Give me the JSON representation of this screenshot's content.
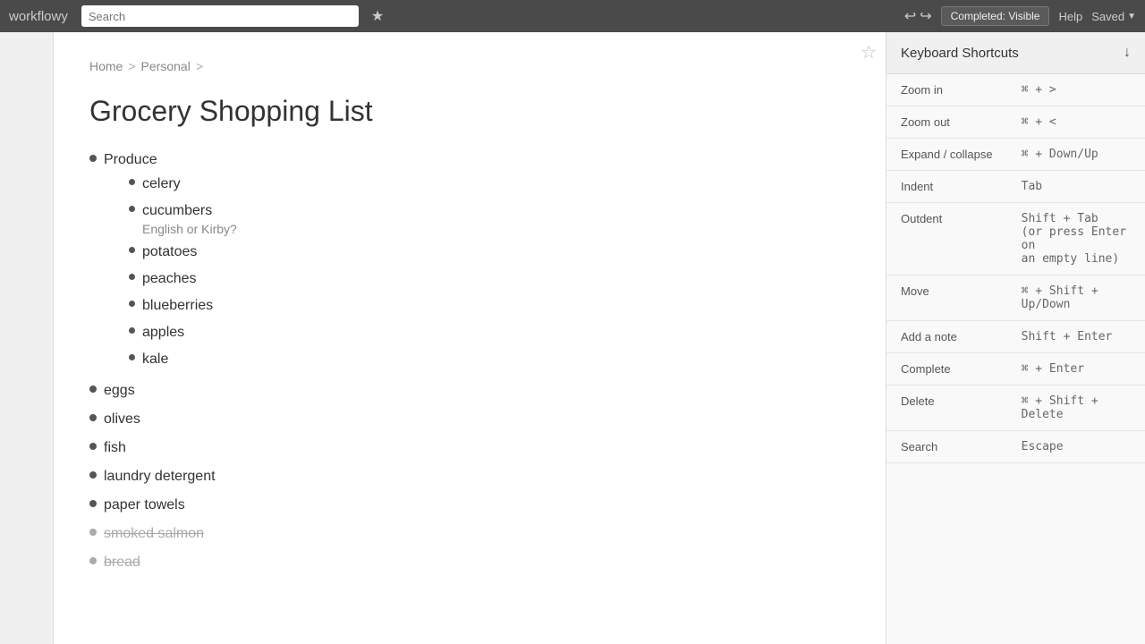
{
  "topbar": {
    "logo": "workflowy",
    "search_placeholder": "Search",
    "star_icon": "★",
    "undo_icon": "↩",
    "redo_icon": "↪",
    "completed_label": "Completed: Visible",
    "help_label": "Help",
    "saved_label": "Saved"
  },
  "breadcrumb": {
    "home": "Home",
    "sep1": ">",
    "personal": "Personal",
    "sep2": ">"
  },
  "page": {
    "title": "Grocery Shopping List"
  },
  "list": {
    "items": [
      {
        "id": "produce",
        "text": "Produce",
        "completed": false,
        "children": [
          {
            "id": "celery",
            "text": "celery",
            "note": "",
            "completed": false
          },
          {
            "id": "cucumbers",
            "text": "cucumbers",
            "note": "English or Kirby?",
            "completed": false
          },
          {
            "id": "potatoes",
            "text": "potatoes",
            "note": "",
            "completed": false
          },
          {
            "id": "peaches",
            "text": "peaches",
            "note": "",
            "completed": false
          },
          {
            "id": "blueberries",
            "text": "blueberries",
            "note": "",
            "completed": false
          },
          {
            "id": "apples",
            "text": "apples",
            "note": "",
            "completed": false
          },
          {
            "id": "kale",
            "text": "kale",
            "note": "",
            "completed": false
          }
        ]
      },
      {
        "id": "eggs",
        "text": "eggs",
        "completed": false
      },
      {
        "id": "olives",
        "text": "olives",
        "completed": false
      },
      {
        "id": "fish",
        "text": "fish",
        "completed": false
      },
      {
        "id": "laundry-detergent",
        "text": "laundry detergent",
        "completed": false
      },
      {
        "id": "paper-towels",
        "text": "paper towels",
        "completed": false
      },
      {
        "id": "smoked-salmon",
        "text": "smoked salmon",
        "completed": true
      },
      {
        "id": "bread",
        "text": "bread",
        "completed": true
      }
    ]
  },
  "shortcuts": {
    "title": "Keyboard Shortcuts",
    "down_arrow": "↓",
    "rows": [
      {
        "action": "Zoom in",
        "key": "⌘ + >"
      },
      {
        "action": "Zoom out",
        "key": "⌘ + <"
      },
      {
        "action": "Expand / collapse",
        "key": "⌘ + Down/Up"
      },
      {
        "action": "Indent",
        "key": "Tab"
      },
      {
        "action": "Outdent",
        "key": "Shift + Tab\n(or press Enter on\nan empty line)"
      },
      {
        "action": "Move",
        "key": "⌘ + Shift + Up/Down"
      },
      {
        "action": "Add a note",
        "key": "Shift + Enter"
      },
      {
        "action": "Complete",
        "key": "⌘ + Enter"
      },
      {
        "action": "Delete",
        "key": "⌘ + Shift + Delete"
      },
      {
        "action": "Search",
        "key": "Escape"
      }
    ]
  }
}
